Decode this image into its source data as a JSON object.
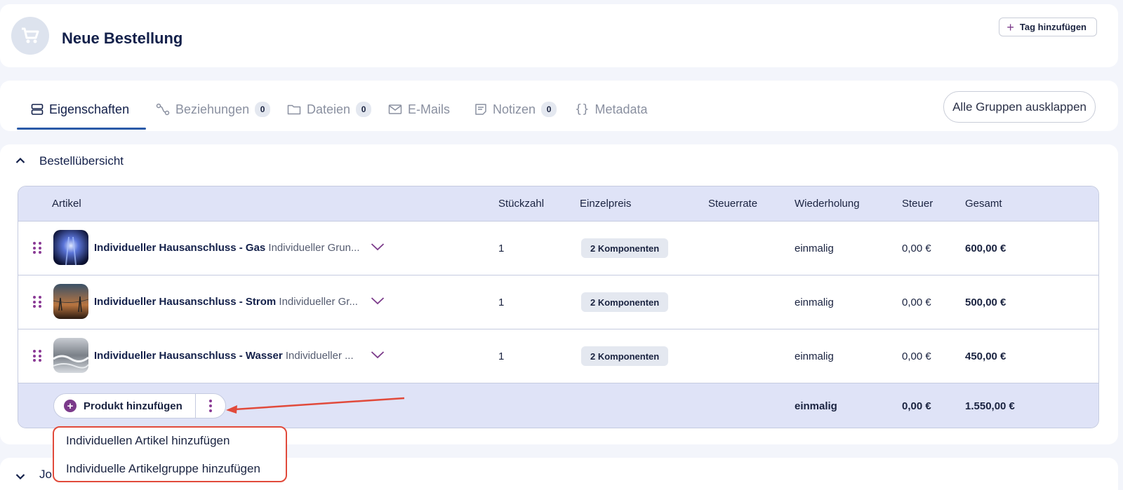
{
  "header": {
    "title": "Neue Bestellung",
    "tag_button": "Tag hinzufügen",
    "avatar_icon": "cart-icon"
  },
  "tabs": [
    {
      "label": "Eigenschaften",
      "icon": "properties-icon",
      "active": true
    },
    {
      "label": "Beziehungen",
      "icon": "relations-icon",
      "count": "0"
    },
    {
      "label": "Dateien",
      "icon": "folder-icon",
      "count": "0"
    },
    {
      "label": "E-Mails",
      "icon": "mail-icon"
    },
    {
      "label": "Notizen",
      "icon": "notes-icon",
      "count": "0"
    },
    {
      "label": "Metadata",
      "icon": "braces-icon"
    }
  ],
  "expand_all": "Alle Gruppen ausklappen",
  "section": {
    "title": "Bestellübersicht"
  },
  "table": {
    "headers": {
      "article": "Artikel",
      "qty": "Stückzahl",
      "unit_price": "Einzelpreis",
      "tax_rate": "Steuerrate",
      "recurrence": "Wiederholung",
      "tax": "Steuer",
      "total": "Gesamt"
    },
    "rows": [
      {
        "name": "Individueller Hausanschluss - Gas",
        "desc": "Individueller Grun...",
        "qty": "1",
        "components": "2 Komponenten",
        "recurrence": "einmalig",
        "tax": "0,00 €",
        "total": "600,00 €"
      },
      {
        "name": "Individueller Hausanschluss - Strom",
        "desc": "Individueller Gr...",
        "qty": "1",
        "components": "2 Komponenten",
        "recurrence": "einmalig",
        "tax": "0,00 €",
        "total": "500,00 €"
      },
      {
        "name": "Individueller Hausanschluss - Wasser",
        "desc": "Individueller ...",
        "qty": "1",
        "components": "2 Komponenten",
        "recurrence": "einmalig",
        "tax": "0,00 €",
        "total": "450,00 €"
      }
    ],
    "footer": {
      "add_product": "Produkt hinzufügen",
      "recurrence": "einmalig",
      "tax": "0,00 €",
      "total": "1.550,00 €"
    }
  },
  "menu": {
    "items": [
      "Individuellen Artikel hinzufügen",
      "Individuelle Artikelgruppe hinzufügen"
    ]
  },
  "bottom_section": {
    "label": "Jo"
  },
  "colors": {
    "accent": "#7b3a8a",
    "tab_underline": "#2a5aa8",
    "highlight": "#e14a3b",
    "table_header": "#dfe3f7"
  }
}
